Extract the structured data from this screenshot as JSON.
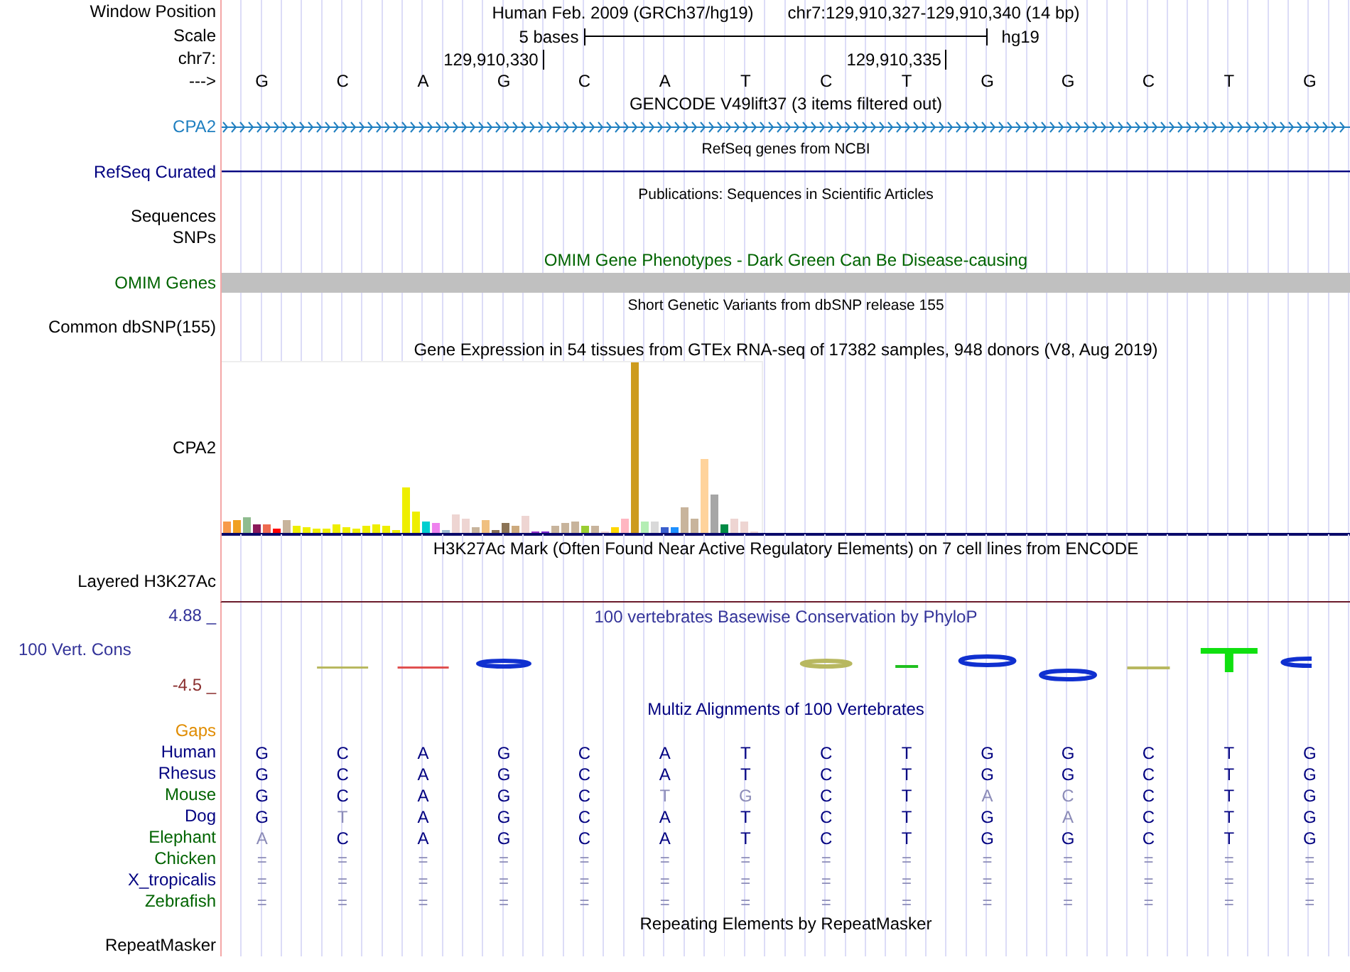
{
  "tracks": [
    {
      "kind": "position",
      "label": "Window Position",
      "assembly": "Human Feb. 2009 (GRCh37/hg19)",
      "range": "chr7:129,910,327-129,910,340 (14 bp)"
    },
    {
      "kind": "scale",
      "label": "Scale",
      "span": "5 bases",
      "assembly": "hg19"
    },
    {
      "kind": "coords",
      "label": "chr7:",
      "ticks": [
        "129,910,330",
        "129,910,335"
      ]
    },
    {
      "kind": "bases",
      "label": "--->",
      "bases": [
        "G",
        "C",
        "A",
        "G",
        "C",
        "A",
        "T",
        "C",
        "T",
        "G",
        "G",
        "C",
        "T",
        "G"
      ]
    },
    {
      "kind": "title",
      "text": "GENCODE V49lift37 (3 items filtered out)"
    },
    {
      "kind": "gene",
      "label": "CPA2",
      "color": "#1f7fc0"
    },
    {
      "kind": "subtitle",
      "text": "RefSeq genes from NCBI"
    },
    {
      "kind": "line",
      "label": "RefSeq Curated",
      "color": "#000080"
    },
    {
      "kind": "subtitle",
      "text": "Publications: Sequences in Scientific Articles"
    },
    {
      "kind": "empty",
      "label": "Sequences"
    },
    {
      "kind": "empty",
      "label": "SNPs"
    },
    {
      "kind": "title",
      "text": "OMIM Gene Phenotypes - Dark Green Can Be Disease-causing",
      "color": "#006400"
    },
    {
      "kind": "bar",
      "label": "OMIM Genes",
      "color": "#006400"
    },
    {
      "kind": "subtitle",
      "text": "Short Genetic Variants from dbSNP release 155"
    },
    {
      "kind": "empty",
      "label": "Common dbSNP(155)"
    },
    {
      "kind": "title",
      "text": "Gene Expression in 54 tissues from GTEx RNA-seq of 17382 samples, 948 donors (V8, Aug 2019)"
    },
    {
      "kind": "expression",
      "label": "CPA2"
    },
    {
      "kind": "title",
      "text": "H3K27Ac Mark (Often Found Near Active Regulatory Elements) on 7 cell lines from ENCODE"
    },
    {
      "kind": "layered",
      "label": "Layered H3K27Ac"
    },
    {
      "kind": "conservation",
      "label": "100 Vert. Cons",
      "color": "#333399",
      "title": "100 vertebrates Basewise Conservation by PhyloP",
      "max": "4.88 _",
      "min": "-4.5 _"
    },
    {
      "kind": "title",
      "text": "Multiz Alignments of 100 Vertebrates",
      "color": "#000080"
    },
    {
      "kind": "empty",
      "label": "Gaps",
      "color": "#e08c00"
    },
    {
      "kind": "alignment",
      "label": "Human",
      "color": "#000080",
      "bases": [
        {
          "base": "G",
          "faded": false
        },
        {
          "base": "C",
          "faded": false
        },
        {
          "base": "A",
          "faded": false
        },
        {
          "base": "G",
          "faded": false
        },
        {
          "base": "C",
          "faded": false
        },
        {
          "base": "A",
          "faded": false
        },
        {
          "base": "T",
          "faded": false
        },
        {
          "base": "C",
          "faded": false
        },
        {
          "base": "T",
          "faded": false
        },
        {
          "base": "G",
          "faded": false
        },
        {
          "base": "G",
          "faded": false
        },
        {
          "base": "C",
          "faded": false
        },
        {
          "base": "T",
          "faded": false
        },
        {
          "base": "G",
          "faded": false
        }
      ]
    },
    {
      "kind": "alignment",
      "label": "Rhesus",
      "color": "#000080",
      "bases": [
        {
          "base": "G",
          "faded": false
        },
        {
          "base": "C",
          "faded": false
        },
        {
          "base": "A",
          "faded": false
        },
        {
          "base": "G",
          "faded": false
        },
        {
          "base": "C",
          "faded": false
        },
        {
          "base": "A",
          "faded": false
        },
        {
          "base": "T",
          "faded": false
        },
        {
          "base": "C",
          "faded": false
        },
        {
          "base": "T",
          "faded": false
        },
        {
          "base": "G",
          "faded": false
        },
        {
          "base": "G",
          "faded": false
        },
        {
          "base": "C",
          "faded": false
        },
        {
          "base": "T",
          "faded": false
        },
        {
          "base": "G",
          "faded": false
        }
      ]
    },
    {
      "kind": "alignment",
      "label": "Mouse",
      "color": "#006400",
      "bases": [
        {
          "base": "G",
          "faded": false
        },
        {
          "base": "C",
          "faded": false
        },
        {
          "base": "A",
          "faded": false
        },
        {
          "base": "G",
          "faded": false
        },
        {
          "base": "C",
          "faded": false
        },
        {
          "base": "T",
          "faded": true
        },
        {
          "base": "G",
          "faded": true
        },
        {
          "base": "C",
          "faded": false
        },
        {
          "base": "T",
          "faded": false
        },
        {
          "base": "A",
          "faded": true
        },
        {
          "base": "C",
          "faded": true
        },
        {
          "base": "C",
          "faded": false
        },
        {
          "base": "T",
          "faded": false
        },
        {
          "base": "G",
          "faded": false
        }
      ]
    },
    {
      "kind": "alignment",
      "label": "Dog",
      "color": "#000080",
      "bases": [
        {
          "base": "G",
          "faded": false
        },
        {
          "base": "T",
          "faded": true
        },
        {
          "base": "A",
          "faded": false
        },
        {
          "base": "G",
          "faded": false
        },
        {
          "base": "C",
          "faded": false
        },
        {
          "base": "A",
          "faded": false
        },
        {
          "base": "T",
          "faded": false
        },
        {
          "base": "C",
          "faded": false
        },
        {
          "base": "T",
          "faded": false
        },
        {
          "base": "G",
          "faded": false
        },
        {
          "base": "A",
          "faded": true
        },
        {
          "base": "C",
          "faded": false
        },
        {
          "base": "T",
          "faded": false
        },
        {
          "base": "G",
          "faded": false
        }
      ]
    },
    {
      "kind": "alignment",
      "label": "Elephant",
      "color": "#006400",
      "bases": [
        {
          "base": "A",
          "faded": true
        },
        {
          "base": "C",
          "faded": false
        },
        {
          "base": "A",
          "faded": false
        },
        {
          "base": "G",
          "faded": false
        },
        {
          "base": "C",
          "faded": false
        },
        {
          "base": "A",
          "faded": false
        },
        {
          "base": "T",
          "faded": false
        },
        {
          "base": "C",
          "faded": false
        },
        {
          "base": "T",
          "faded": false
        },
        {
          "base": "G",
          "faded": false
        },
        {
          "base": "G",
          "faded": false
        },
        {
          "base": "C",
          "faded": false
        },
        {
          "base": "T",
          "faded": false
        },
        {
          "base": "G",
          "faded": false
        }
      ]
    },
    {
      "kind": "alignment",
      "label": "Chicken",
      "color": "#006400",
      "bases": [
        {
          "base": "=",
          "faded": true
        },
        {
          "base": "=",
          "faded": true
        },
        {
          "base": "=",
          "faded": true
        },
        {
          "base": "=",
          "faded": true
        },
        {
          "base": "=",
          "faded": true
        },
        {
          "base": "=",
          "faded": true
        },
        {
          "base": "=",
          "faded": true
        },
        {
          "base": "=",
          "faded": true
        },
        {
          "base": "=",
          "faded": true
        },
        {
          "base": "=",
          "faded": true
        },
        {
          "base": "=",
          "faded": true
        },
        {
          "base": "=",
          "faded": true
        },
        {
          "base": "=",
          "faded": true
        },
        {
          "base": "=",
          "faded": true
        }
      ]
    },
    {
      "kind": "alignment",
      "label": "X_tropicalis",
      "color": "#000080",
      "bases": [
        {
          "base": "=",
          "faded": true
        },
        {
          "base": "=",
          "faded": true
        },
        {
          "base": "=",
          "faded": true
        },
        {
          "base": "=",
          "faded": true
        },
        {
          "base": "=",
          "faded": true
        },
        {
          "base": "=",
          "faded": true
        },
        {
          "base": "=",
          "faded": true
        },
        {
          "base": "=",
          "faded": true
        },
        {
          "base": "=",
          "faded": true
        },
        {
          "base": "=",
          "faded": true
        },
        {
          "base": "=",
          "faded": true
        },
        {
          "base": "=",
          "faded": true
        },
        {
          "base": "=",
          "faded": true
        },
        {
          "base": "=",
          "faded": true
        }
      ]
    },
    {
      "kind": "alignment",
      "label": "Zebrafish",
      "color": "#006400",
      "bases": [
        {
          "base": "=",
          "faded": true
        },
        {
          "base": "=",
          "faded": true
        },
        {
          "base": "=",
          "faded": true
        },
        {
          "base": "=",
          "faded": true
        },
        {
          "base": "=",
          "faded": true
        },
        {
          "base": "=",
          "faded": true
        },
        {
          "base": "=",
          "faded": true
        },
        {
          "base": "=",
          "faded": true
        },
        {
          "base": "=",
          "faded": true
        },
        {
          "base": "=",
          "faded": true
        },
        {
          "base": "=",
          "faded": true
        },
        {
          "base": "=",
          "faded": true
        },
        {
          "base": "=",
          "faded": true
        },
        {
          "base": "=",
          "faded": true
        }
      ]
    },
    {
      "kind": "title",
      "text": "Repeating Elements by RepeatMasker"
    },
    {
      "kind": "empty",
      "label": "RepeatMasker"
    }
  ]
}
